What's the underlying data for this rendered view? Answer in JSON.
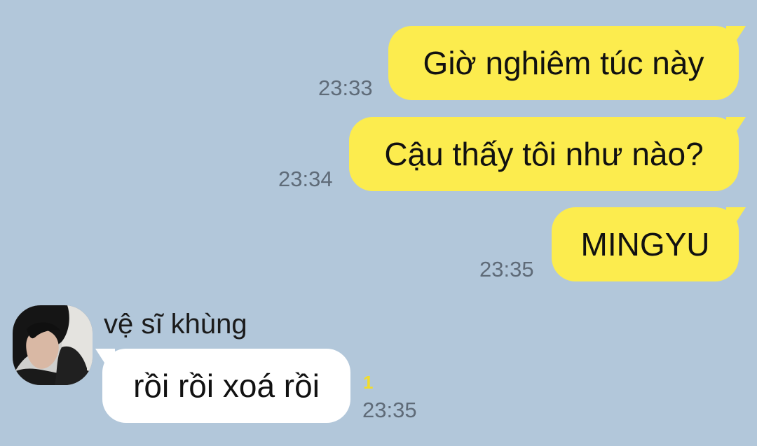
{
  "chat": {
    "messages_out": [
      {
        "text": "Giờ nghiêm túc này",
        "time": "23:33"
      },
      {
        "text": "Cậu thấy tôi như nào?",
        "time": "23:34"
      },
      {
        "text": "MINGYU",
        "time": "23:35"
      }
    ],
    "message_in": {
      "sender": "vệ sĩ khùng",
      "text": "rồi rồi xoá rồi",
      "unread": "1",
      "time": "23:35"
    }
  },
  "colors": {
    "background": "#b2c7da",
    "outgoing_bubble": "#fcec4e",
    "incoming_bubble": "#ffffff",
    "timestamp": "#5f6b78",
    "unread_count": "#f1dc2c"
  },
  "icons": {
    "avatar": "profile-photo"
  }
}
